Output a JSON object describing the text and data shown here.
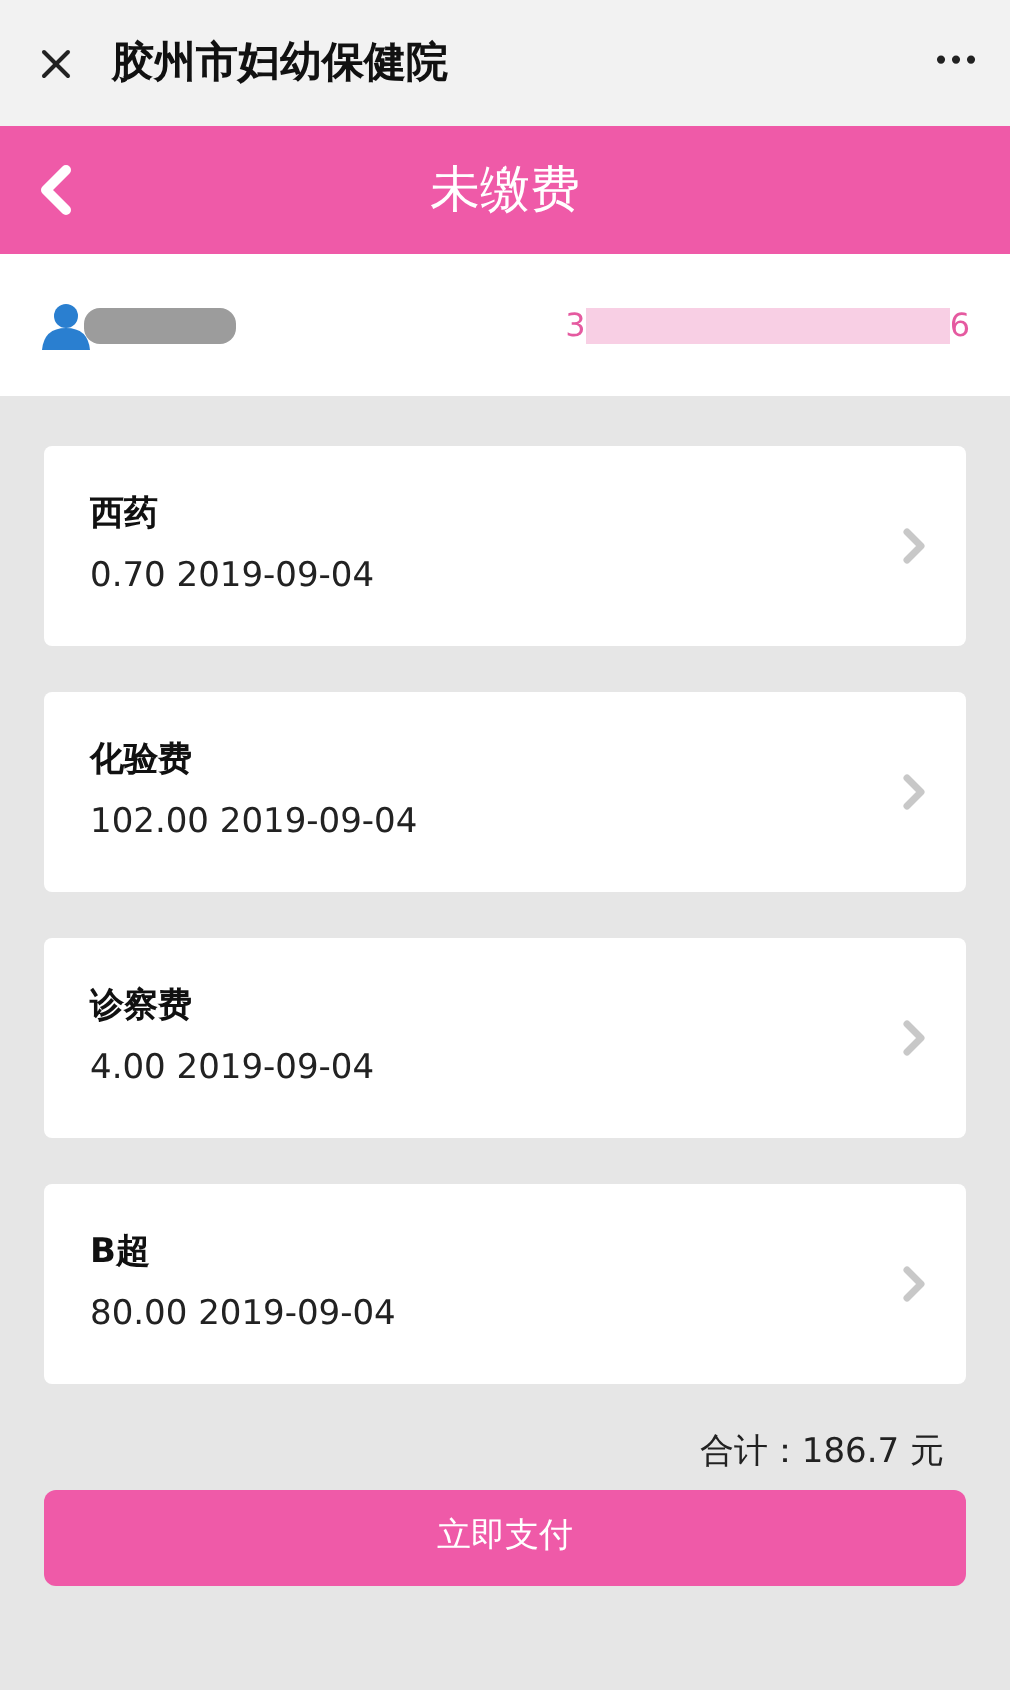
{
  "window": {
    "title": "胶州市妇幼保健院",
    "more": "•••"
  },
  "header": {
    "title": "未缴费"
  },
  "patient": {
    "id_start": "3",
    "id_end": "6"
  },
  "bills": [
    {
      "name": "西药",
      "detail": "0.70 2019-09-04"
    },
    {
      "name": "化验费",
      "detail": "102.00 2019-09-04"
    },
    {
      "name": "诊察费",
      "detail": "4.00 2019-09-04"
    },
    {
      "name": "B超",
      "detail": "80.00 2019-09-04"
    }
  ],
  "total": "合计：186.7 元",
  "pay_button": "立即支付"
}
